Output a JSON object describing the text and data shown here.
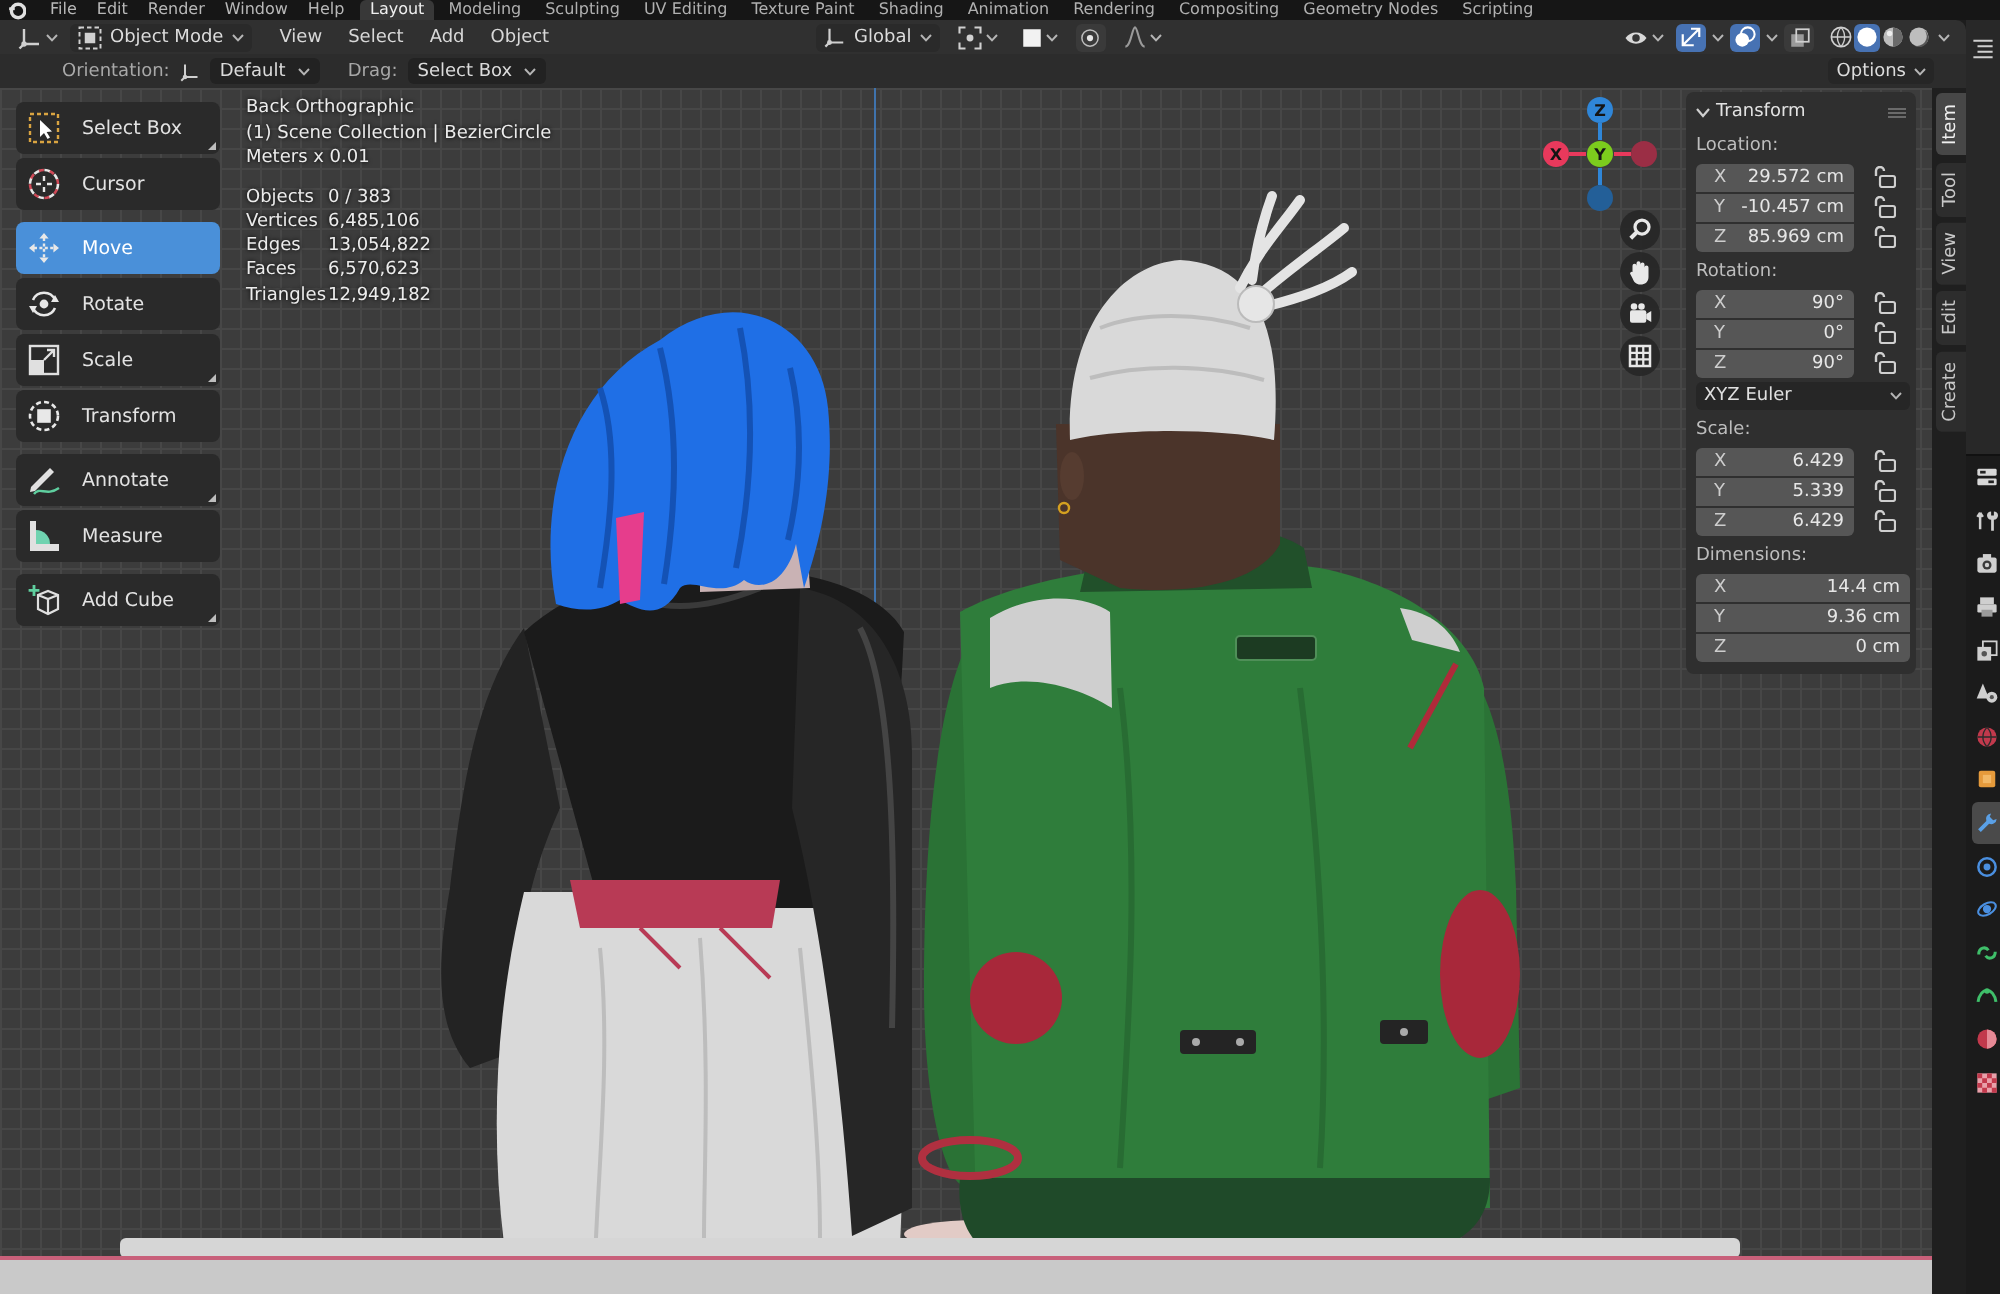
{
  "topbar": {
    "menus": [
      "File",
      "Edit",
      "Render",
      "Window",
      "Help"
    ],
    "workspaces": [
      {
        "label": "Layout",
        "selected": true
      },
      {
        "label": "Modeling",
        "selected": false
      },
      {
        "label": "Sculpting",
        "selected": false
      },
      {
        "label": "UV Editing",
        "selected": false
      },
      {
        "label": "Texture Paint",
        "selected": false
      },
      {
        "label": "Shading",
        "selected": false
      },
      {
        "label": "Animation",
        "selected": false
      },
      {
        "label": "Rendering",
        "selected": false
      },
      {
        "label": "Compositing",
        "selected": false
      },
      {
        "label": "Geometry Nodes",
        "selected": false
      },
      {
        "label": "Scripting",
        "selected": false
      }
    ]
  },
  "header": {
    "mode": "Object Mode",
    "menus": [
      "View",
      "Select",
      "Add",
      "Object"
    ],
    "orientation": "Global",
    "gizmo_toggle": {
      "on": true
    },
    "overlay_toggle": {
      "on": true
    },
    "xray_toggle": {
      "on": false
    },
    "shading": [
      {
        "kind": "wireframe",
        "selected": false
      },
      {
        "kind": "solid",
        "selected": true
      },
      {
        "kind": "material",
        "selected": false
      },
      {
        "kind": "rendered",
        "selected": false
      }
    ]
  },
  "tool_settings": {
    "orientation_label": "Orientation:",
    "orientation": "Default",
    "drag_label": "Drag:",
    "drag": "Select Box",
    "options": "Options"
  },
  "toolbar": {
    "groups": [
      {
        "tools": [
          {
            "kind": "select_box",
            "label": "Select Box",
            "selected": false,
            "variants": true
          },
          {
            "kind": "cursor",
            "label": "Cursor",
            "selected": false,
            "variants": false
          }
        ]
      },
      {
        "tools": [
          {
            "kind": "move",
            "label": "Move",
            "selected": true,
            "variants": false
          },
          {
            "kind": "rotate",
            "label": "Rotate",
            "selected": false,
            "variants": false
          },
          {
            "kind": "scale",
            "label": "Scale",
            "selected": false,
            "variants": true
          },
          {
            "kind": "transform",
            "label": "Transform",
            "selected": false,
            "variants": false
          }
        ]
      },
      {
        "tools": [
          {
            "kind": "annotate",
            "label": "Annotate",
            "selected": false,
            "variants": true
          },
          {
            "kind": "measure",
            "label": "Measure",
            "selected": false,
            "variants": false
          }
        ]
      },
      {
        "tools": [
          {
            "kind": "add_cube",
            "label": "Add Cube",
            "selected": false,
            "variants": true
          }
        ]
      }
    ]
  },
  "viewport_info": {
    "lines": [
      "Back Orthographic",
      "(1) Scene Collection | BezierCircle",
      "Meters x 0.01"
    ],
    "stats": [
      {
        "label": "Objects",
        "value": "0 / 383"
      },
      {
        "label": "Vertices",
        "value": "6,485,106"
      },
      {
        "label": "Edges",
        "value": "13,054,822"
      },
      {
        "label": "Faces",
        "value": "6,570,623"
      },
      {
        "label": "Triangles",
        "value": "12,949,182"
      }
    ]
  },
  "gizmo": {
    "axes": [
      {
        "kind": "neg_x"
      },
      {
        "kind": "neg_z"
      },
      {
        "kind": "z",
        "label": "Z"
      },
      {
        "kind": "x",
        "label": "X"
      },
      {
        "kind": "y",
        "label": "Y"
      }
    ]
  },
  "sidebar": {
    "title": "Transform",
    "sections": [
      {
        "kind": "vector",
        "label": "Location:",
        "fields": [
          {
            "axis": "X",
            "value": "29.572 cm",
            "locked": false
          },
          {
            "axis": "Y",
            "value": "-10.457 cm",
            "locked": false
          },
          {
            "axis": "Z",
            "value": "85.969 cm",
            "locked": false
          }
        ]
      },
      {
        "kind": "vector",
        "label": "Rotation:",
        "fields": [
          {
            "axis": "X",
            "value": "90°",
            "locked": false
          },
          {
            "axis": "Y",
            "value": "0°",
            "locked": false
          },
          {
            "axis": "Z",
            "value": "90°",
            "locked": false
          }
        ]
      },
      {
        "kind": "dropdown",
        "value": "XYZ Euler"
      },
      {
        "kind": "vector",
        "label": "Scale:",
        "fields": [
          {
            "axis": "X",
            "value": "6.429",
            "locked": false
          },
          {
            "axis": "Y",
            "value": "5.339",
            "locked": false
          },
          {
            "axis": "Z",
            "value": "6.429",
            "locked": false
          }
        ]
      },
      {
        "kind": "vector",
        "label": "Dimensions:",
        "fields": [
          {
            "axis": "X",
            "value": "14.4 cm"
          },
          {
            "axis": "Y",
            "value": "9.36 cm"
          },
          {
            "axis": "Z",
            "value": "0 cm"
          }
        ]
      }
    ],
    "tabs": [
      {
        "label": "Item",
        "selected": true
      },
      {
        "label": "Tool",
        "selected": false
      },
      {
        "label": "View",
        "selected": false
      },
      {
        "label": "Edit",
        "selected": false
      },
      {
        "label": "Create",
        "selected": false
      }
    ]
  },
  "properties_tabs": [
    {
      "kind": "editor",
      "selected": false
    },
    {
      "kind": "tool",
      "selected": false
    },
    {
      "kind": "render",
      "selected": false
    },
    {
      "kind": "output",
      "selected": false
    },
    {
      "kind": "view_layer",
      "selected": false
    },
    {
      "kind": "scene",
      "selected": false
    },
    {
      "kind": "world",
      "selected": false
    },
    {
      "kind": "object",
      "selected": false
    },
    {
      "kind": "modifiers",
      "selected": true
    },
    {
      "kind": "particles",
      "selected": false
    },
    {
      "kind": "physics",
      "selected": false
    },
    {
      "kind": "constraints",
      "selected": false
    },
    {
      "kind": "data",
      "selected": false
    },
    {
      "kind": "material",
      "selected": false
    },
    {
      "kind": "texture",
      "selected": false
    }
  ]
}
